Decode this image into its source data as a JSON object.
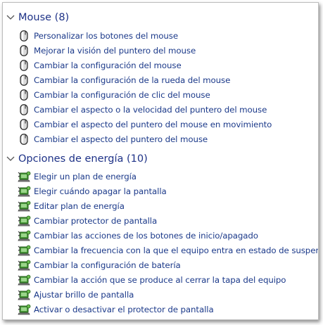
{
  "groups": [
    {
      "title": "Mouse (8)",
      "icon": "mouse-icon",
      "items": [
        {
          "label": "Personalizar los botones del mouse"
        },
        {
          "label": "Mejorar la visión del puntero del mouse"
        },
        {
          "label": "Cambiar la configuración del mouse"
        },
        {
          "label": "Cambiar la configuración de la rueda del mouse"
        },
        {
          "label": "Cambiar la configuración de clic del mouse"
        },
        {
          "label": "Cambiar el aspecto o la velocidad del puntero del mouse"
        },
        {
          "label": "Cambiar el aspecto del puntero del mouse en movimiento"
        },
        {
          "label": "Cambiar el aspecto del puntero del mouse"
        }
      ]
    },
    {
      "title": "Opciones de energía (10)",
      "icon": "power-options-icon",
      "items": [
        {
          "label": "Elegir un plan de energía"
        },
        {
          "label": "Elegir cuándo apagar la pantalla"
        },
        {
          "label": "Editar plan de energía"
        },
        {
          "label": "Cambiar protector de pantalla"
        },
        {
          "label": "Cambiar las acciones de los botones de inicio/apagado"
        },
        {
          "label": "Cambiar la frecuencia con la que el equipo entra en estado de suspensión"
        },
        {
          "label": "Cambiar la configuración de batería"
        },
        {
          "label": "Cambiar la acción que se produce al cerrar la tapa del equipo"
        },
        {
          "label": "Ajustar brillo de pantalla"
        },
        {
          "label": "Activar o desactivar el protector de pantalla"
        }
      ]
    }
  ]
}
